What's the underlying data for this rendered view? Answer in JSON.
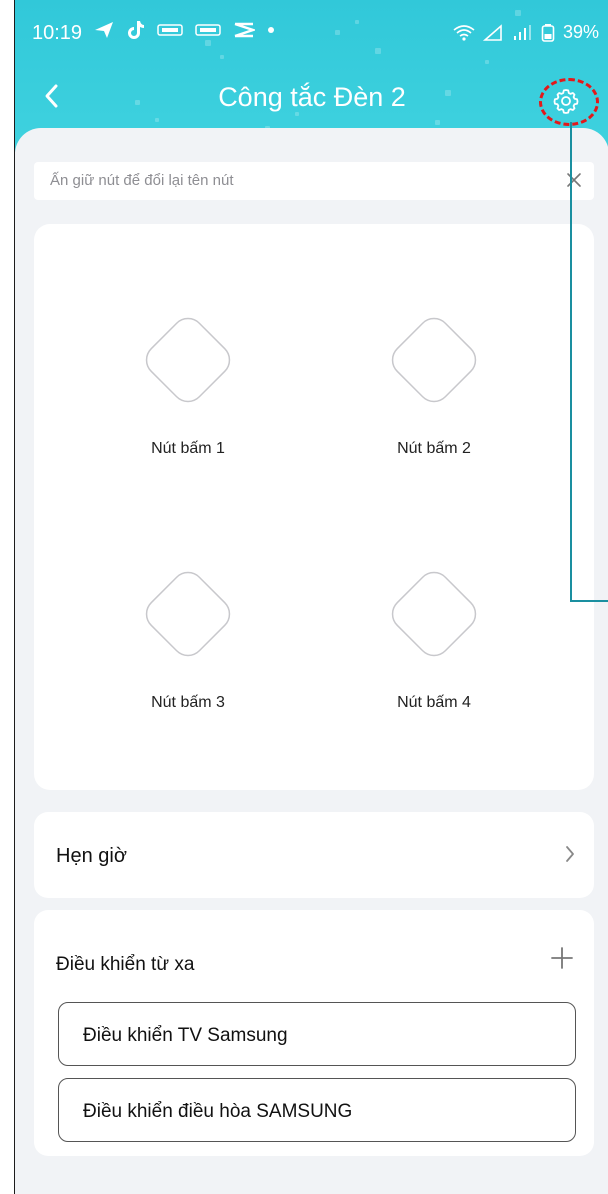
{
  "status_bar": {
    "time": "10:19",
    "battery": "39%",
    "icons": [
      "nav-arrow-icon",
      "tiktok-icon",
      "news-app-icon",
      "news-app-icon",
      "capcut-icon",
      "dot-icon"
    ],
    "right_icons": [
      "wifi-icon",
      "signal-icon",
      "battery-icon"
    ]
  },
  "header": {
    "title": "Công tắc Đèn 2",
    "back_icon": "chevron-left-icon",
    "settings_icon": "gear-icon",
    "color": "#3bcfdd"
  },
  "hint": {
    "text": "Ấn giữ nút để đổi lại tên nút",
    "close_icon": "close-icon"
  },
  "buttons": [
    {
      "label": "Nút bấm 1"
    },
    {
      "label": "Nút bấm 2"
    },
    {
      "label": "Nút bấm 3"
    },
    {
      "label": "Nút bấm 4"
    }
  ],
  "timer": {
    "label": "Hẹn giờ",
    "chevron_icon": "chevron-right-icon"
  },
  "remote": {
    "title": "Điều khiển từ xa",
    "add_icon": "plus-icon",
    "items": [
      {
        "label": "Điều khiển TV Samsung"
      },
      {
        "label": "Điều khiển điều hòa SAMSUNG"
      }
    ]
  },
  "annotation": {
    "color": "#e3181a"
  }
}
